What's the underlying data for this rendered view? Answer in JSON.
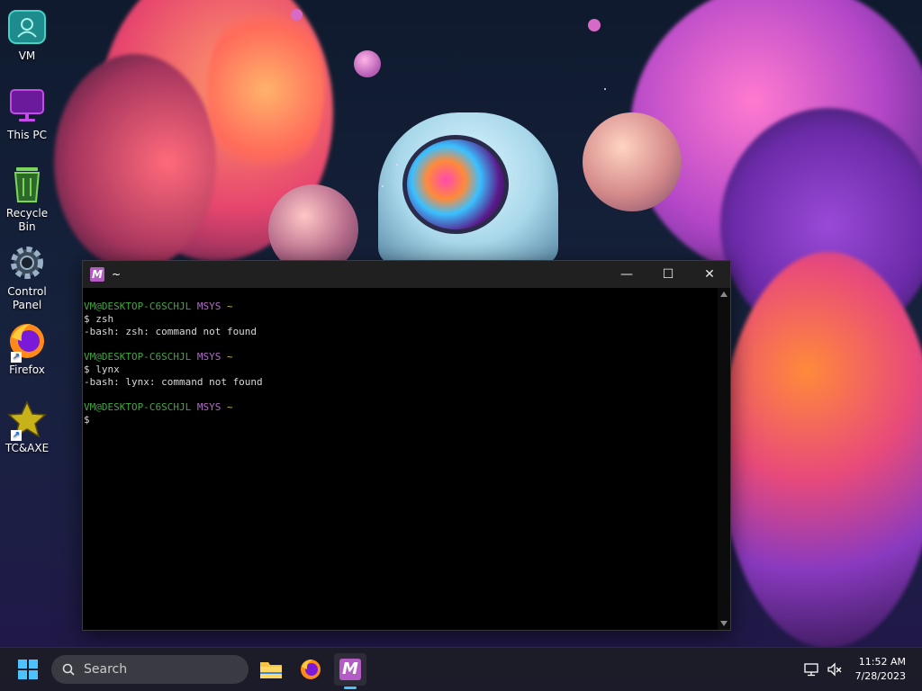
{
  "desktop": {
    "icons": [
      {
        "label": "VM",
        "icon": "user-folder-icon"
      },
      {
        "label": "This PC",
        "icon": "monitor-icon"
      },
      {
        "label": "Recycle Bin",
        "icon": "recycle-bin-icon"
      },
      {
        "label": "Control Panel",
        "icon": "gear-icon"
      },
      {
        "label": "Firefox",
        "icon": "firefox-icon"
      },
      {
        "label": "TC&AXE",
        "icon": "star-icon"
      }
    ]
  },
  "terminal": {
    "title": "~",
    "app_icon_letter": "M",
    "lines": [
      {
        "user": "VM@DESKTOP-C6SCHJL",
        "env": "MSYS",
        "path": "~"
      },
      {
        "cmd": "$ zsh"
      },
      {
        "out": "-bash: zsh: command not found"
      },
      {
        "blank": ""
      },
      {
        "user": "VM@DESKTOP-C6SCHJL",
        "env": "MSYS",
        "path": "~"
      },
      {
        "cmd": "$ lynx"
      },
      {
        "out": "-bash: lynx: command not found"
      },
      {
        "blank": ""
      },
      {
        "user": "VM@DESKTOP-C6SCHJL",
        "env": "MSYS",
        "path": "~"
      },
      {
        "cmd": "$"
      }
    ],
    "controls": {
      "minimize": "—",
      "maximize": "☐",
      "close": "✕"
    }
  },
  "taskbar": {
    "search_placeholder": "Search",
    "apps": [
      {
        "name": "file-explorer",
        "icon": "folder-icon"
      },
      {
        "name": "firefox",
        "icon": "firefox-icon"
      },
      {
        "name": "msys2",
        "icon": "msys-icon",
        "letter": "M",
        "active": true
      }
    ],
    "clock": {
      "time": "11:52 AM",
      "date": "7/28/2023"
    }
  },
  "colors": {
    "prompt_user": "#3ea83e",
    "prompt_env": "#b36bc8",
    "prompt_path": "#c9bb4b",
    "accent": "#4cc2ff"
  }
}
